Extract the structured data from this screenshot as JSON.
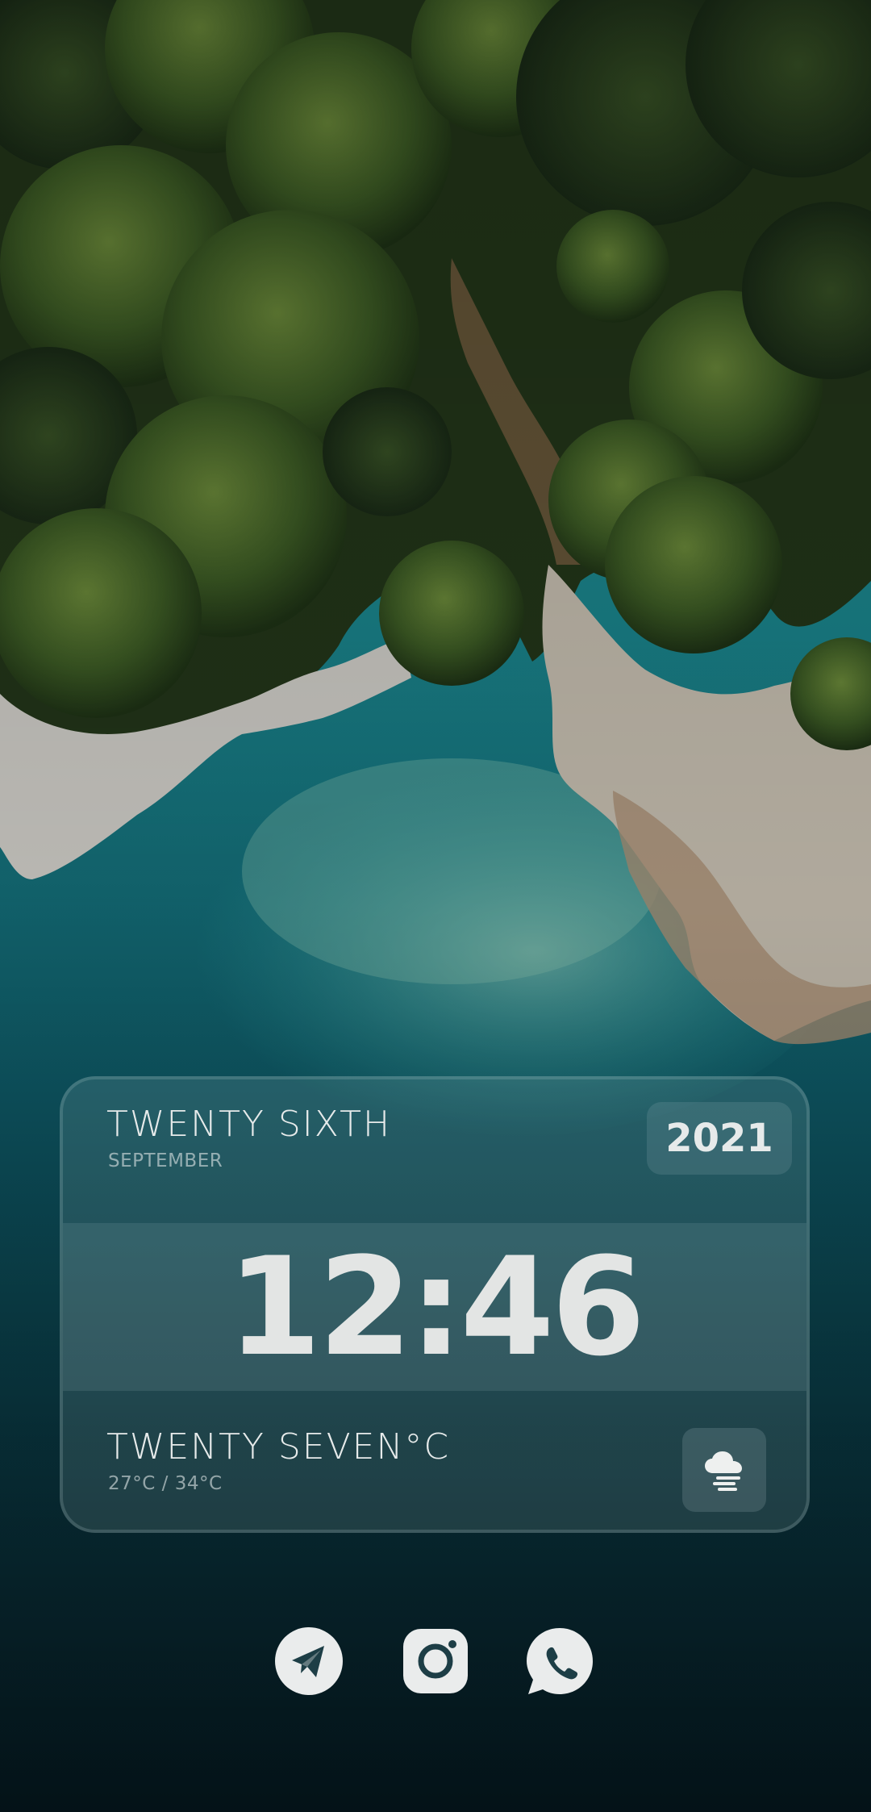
{
  "wallpaper": {
    "description_icon": "aerial-coast-wallpaper"
  },
  "widget": {
    "date_words": "TWENTY SIXTH",
    "month": "SEPTEMBER",
    "year": "2021",
    "time": "12:46",
    "temperature_words": "TWENTY SEVEN°C",
    "temperature_range": "27°C / 34°C",
    "weather_icon": "cloud-fog-icon"
  },
  "dock": {
    "apps": [
      {
        "name": "telegram",
        "icon": "telegram-icon"
      },
      {
        "name": "instagram",
        "icon": "instagram-icon"
      },
      {
        "name": "whatsapp",
        "icon": "whatsapp-icon"
      }
    ]
  },
  "colors": {
    "text": "#e6eaea",
    "water": "#1e8e93",
    "forest": "#2f4a22",
    "rock": "#d8d6d0"
  }
}
